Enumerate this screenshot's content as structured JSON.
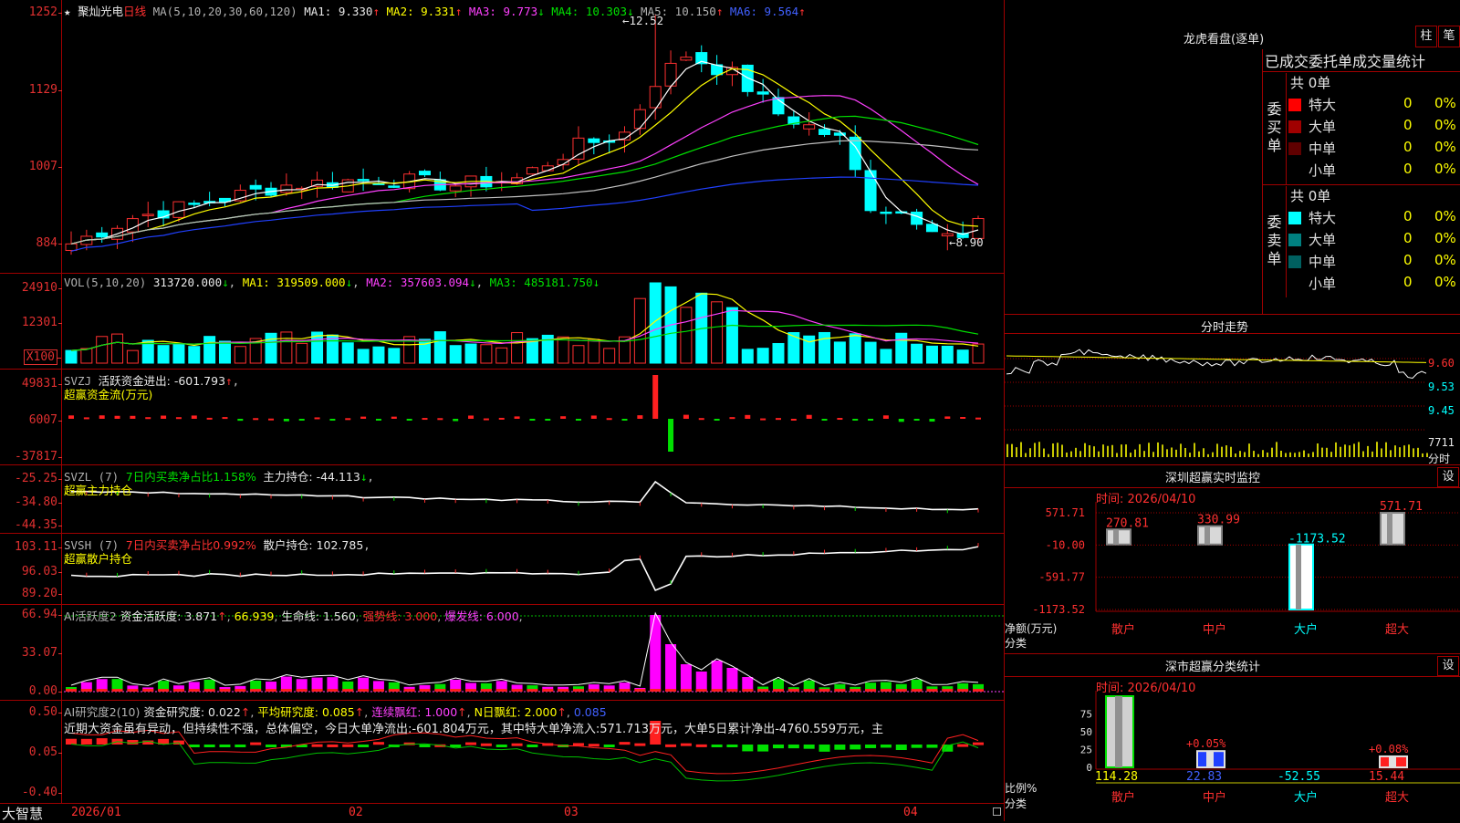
{
  "app": {
    "brand": "大智慧"
  },
  "stock": {
    "name": "聚灿光电",
    "period": "日线",
    "star": "★"
  },
  "kline": {
    "ma_header": "MA(5,10,20,30,60,120)",
    "ma1": "MA1: 9.330",
    "ma2": "MA2: 9.331",
    "ma3": "MA3: 9.773",
    "ma4": "MA4: 10.303",
    "ma5": "MA5: 10.150",
    "ma6": "MA6: 9.564",
    "high_label": "12.52",
    "low_label": "8.90",
    "y_ticks": [
      "1252",
      "1129",
      "1007",
      "884"
    ],
    "colors": {
      "up": "#ff3030",
      "down": "#00ffff",
      "ma1": "#ffffff",
      "ma2": "#ffff00",
      "ma3": "#ff40ff",
      "ma4": "#00e000",
      "ma5": "#c0c0c0",
      "ma6": "#2040ff"
    }
  },
  "volume": {
    "header": "VOL(5,10,20)",
    "value": "313720.000",
    "ma1": "MA1: 319509.000",
    "ma2": "MA2: 357603.094",
    "ma3": "MA3: 485181.750",
    "y_ticks": [
      "24910",
      "12301",
      "X100"
    ]
  },
  "svzj": {
    "title": "SVZJ",
    "label": "活跃资金进出: -601.793",
    "subtitle": "超赢资金流(万元)",
    "y_ticks": [
      "49831",
      "6007",
      "-37817"
    ]
  },
  "svzl": {
    "title": "SVZL (7)",
    "ratio": "7日内买卖净占比1.158%",
    "label": "主力持仓: -44.113",
    "subtitle": "超赢主力持仓",
    "y_ticks": [
      "-25.25",
      "-34.80",
      "-44.35"
    ]
  },
  "svsh": {
    "title": "SVSH (7)",
    "ratio": "7日内买卖净占比0.992%",
    "label": "散户持仓: 102.785",
    "subtitle": "超赢散户持仓",
    "y_ticks": [
      "103.11",
      "96.03",
      "89.20"
    ]
  },
  "ai_active": {
    "title": "AI活跃度2",
    "label": "资金活跃度: 3.871",
    "v2": "66.939",
    "life": "生命线: 1.560",
    "strong": "强势线: 3.000",
    "burst": "爆发线: 6.000",
    "y_ticks": [
      "66.94",
      "33.07",
      "0.00"
    ]
  },
  "ai_research": {
    "title": "AI研究度2(10)",
    "label": "资金研究度: 0.022",
    "avg": "平均研究度: 0.085",
    "cont": "连续飘红: 1.000",
    "nred": "N日飘红: 2.000",
    "last": "0.085",
    "commentary": "近期大资金虽有异动，但持续性不强，总体偏空，今日大单净流出:-601.804万元，其中特大单净流入:571.713万元，大单5日累计净出-4760.559万元，主",
    "y_ticks": [
      "0.50",
      "0.05",
      "-0.40"
    ]
  },
  "x_axis": {
    "labels": [
      "2026/01",
      "02",
      "03",
      "04"
    ]
  },
  "dragon": {
    "title": "龙虎看盘(逐单)",
    "btn1": "柱",
    "btn2": "笔",
    "header": "已成交委托单成交量统计",
    "buy_side": "委买单",
    "sell_side": "委卖单",
    "buy_total": "共 0单",
    "sell_total": "共 0单",
    "buy_rows": [
      {
        "name": "特大",
        "vol": "0",
        "pct": "0%",
        "color": "#ff0000"
      },
      {
        "name": "大单",
        "vol": "0",
        "pct": "0%",
        "color": "#a00000"
      },
      {
        "name": "中单",
        "vol": "0",
        "pct": "0%",
        "color": "#600000"
      },
      {
        "name": "小单",
        "vol": "0",
        "pct": "0%",
        "color": "#000000"
      }
    ],
    "sell_rows": [
      {
        "name": "特大",
        "vol": "0",
        "pct": "0%",
        "color": "#00ffff"
      },
      {
        "name": "大单",
        "vol": "0",
        "pct": "0%",
        "color": "#008080"
      },
      {
        "name": "中单",
        "vol": "0",
        "pct": "0%",
        "color": "#006060"
      },
      {
        "name": "小单",
        "vol": "0",
        "pct": "0%",
        "color": "#000000"
      }
    ]
  },
  "intraday": {
    "title": "分时走势",
    "y_ticks": [
      "9.60",
      "9.53",
      "9.45"
    ],
    "vol_label": "7711",
    "vol_unit": "分时"
  },
  "monitor": {
    "title": "深圳超赢实时监控",
    "btn": "设",
    "date": "时间: 2026/04/10",
    "y_ticks": [
      "571.71",
      "-10.00",
      "-591.77",
      "-1173.52"
    ],
    "y_unit1": "净额(万元)",
    "y_unit2": "分类",
    "categories": [
      "散户",
      "中户",
      "大户",
      "超大"
    ],
    "value_labels": [
      "270.81",
      "330.99",
      "-1173.52",
      "571.71"
    ],
    "chart_data": {
      "type": "bar",
      "categories": [
        "散户",
        "中户",
        "大户",
        "超大"
      ],
      "values": [
        270.81,
        330.99,
        -1173.52,
        571.71
      ],
      "ylim": [
        -1173.52,
        571.71
      ]
    }
  },
  "classify": {
    "title": "深市超赢分类统计",
    "btn": "设",
    "date": "时间: 2026/04/10",
    "y_ticks": [
      "75",
      "50",
      "25",
      "0"
    ],
    "y_unit1": "比例%",
    "y_unit2": "分类",
    "categories": [
      "散户",
      "中户",
      "大户",
      "超大"
    ],
    "top_labels": [
      "",
      "+0.05%",
      "",
      "+0.08%"
    ],
    "bottom_labels": [
      "114.28",
      "22.83",
      "-52.55",
      "15.44"
    ],
    "chart_data": {
      "type": "bar",
      "categories": [
        "散户",
        "中户",
        "大户",
        "超大"
      ],
      "values": [
        100,
        22.83,
        0,
        15.44
      ],
      "ylim": [
        0,
        100
      ]
    }
  }
}
